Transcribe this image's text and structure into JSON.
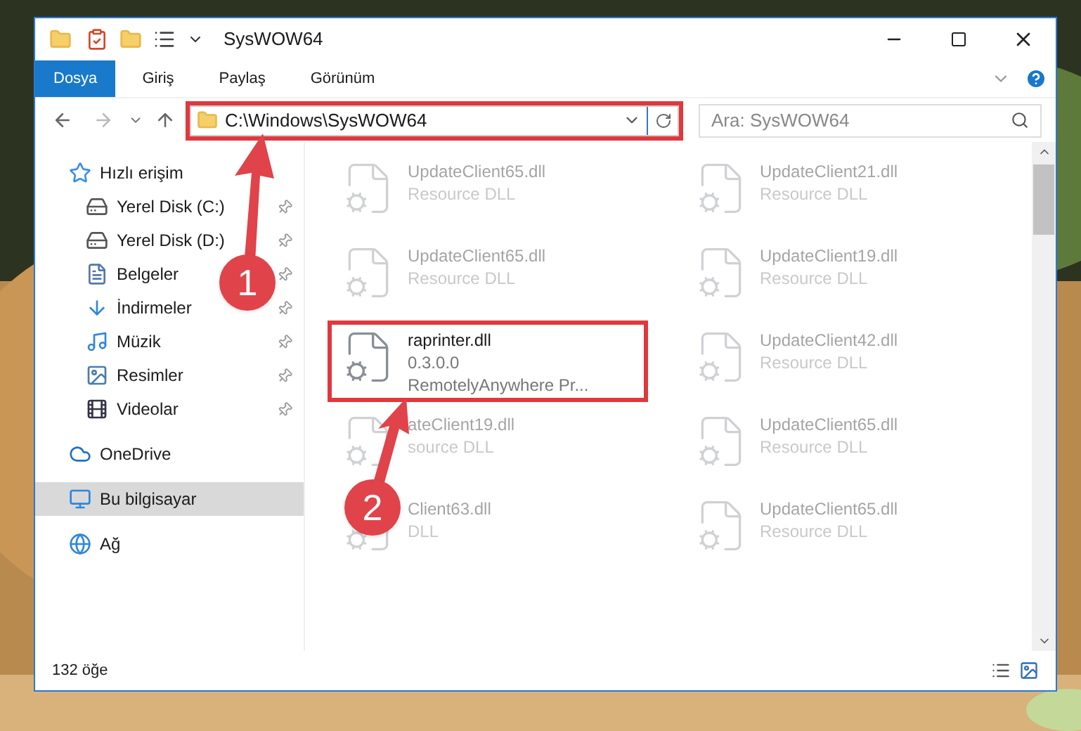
{
  "window": {
    "title": "SysWOW64"
  },
  "ribbon_tabs": [
    {
      "label": "Dosya",
      "selected": true
    },
    {
      "label": "Giriş",
      "selected": false
    },
    {
      "label": "Paylaş",
      "selected": false
    },
    {
      "label": "Görünüm",
      "selected": false
    }
  ],
  "address_bar": {
    "path": "C:\\Windows\\SysWOW64",
    "highlighted": true
  },
  "search": {
    "placeholder": "Ara: SysWOW64"
  },
  "sidebar": {
    "groups": [
      {
        "label": "Hızlı erişim",
        "kind": "star",
        "selected": false,
        "children": [
          {
            "label": "Yerel Disk (C:)",
            "kind": "drive",
            "pinned": true
          },
          {
            "label": "Yerel Disk (D:)",
            "kind": "drive",
            "pinned": true
          },
          {
            "label": "Belgeler",
            "kind": "documents",
            "pinned": true
          },
          {
            "label": "İndirmeler",
            "kind": "downloads",
            "pinned": true
          },
          {
            "label": "Müzik",
            "kind": "music",
            "pinned": true
          },
          {
            "label": "Resimler",
            "kind": "pictures",
            "pinned": true
          },
          {
            "label": "Videolar",
            "kind": "videos",
            "pinned": true
          }
        ]
      },
      {
        "label": "OneDrive",
        "kind": "cloud",
        "selected": false
      },
      {
        "label": "Bu bilgisayar",
        "kind": "computer",
        "selected": true
      },
      {
        "label": "Ağ",
        "kind": "network",
        "selected": false
      }
    ]
  },
  "files": [
    {
      "name": "UpdateClient65.dll",
      "details": [
        "Resource DLL"
      ],
      "faded": true,
      "highlighted": false
    },
    {
      "name": "UpdateClient21.dll",
      "details": [
        "Resource DLL"
      ],
      "faded": true,
      "highlighted": false
    },
    {
      "name": "UpdateClient65.dll",
      "details": [
        "Resource DLL"
      ],
      "faded": true,
      "highlighted": false
    },
    {
      "name": "UpdateClient19.dll",
      "details": [
        "Resource DLL"
      ],
      "faded": true,
      "highlighted": false
    },
    {
      "name": "raprinter.dll",
      "details": [
        "0.3.0.0",
        "RemotelyAnywhere Pr..."
      ],
      "faded": false,
      "highlighted": true
    },
    {
      "name": "UpdateClient42.dll",
      "details": [
        "Resource DLL"
      ],
      "faded": true,
      "highlighted": false
    },
    {
      "name": "ateClient19.dll",
      "details": [
        "source DLL"
      ],
      "faded": true,
      "highlighted": false
    },
    {
      "name": "UpdateClient65.dll",
      "details": [
        "Resource DLL"
      ],
      "faded": true,
      "highlighted": false
    },
    {
      "name": "Client63.dll",
      "details": [
        "DLL"
      ],
      "faded": true,
      "highlighted": false
    },
    {
      "name": "UpdateClient65.dll",
      "details": [
        "Resource DLL"
      ],
      "faded": true,
      "highlighted": false
    }
  ],
  "status_bar": {
    "item_count": "132 öğe"
  },
  "annotations": [
    {
      "label": "1"
    },
    {
      "label": "2"
    }
  ]
}
